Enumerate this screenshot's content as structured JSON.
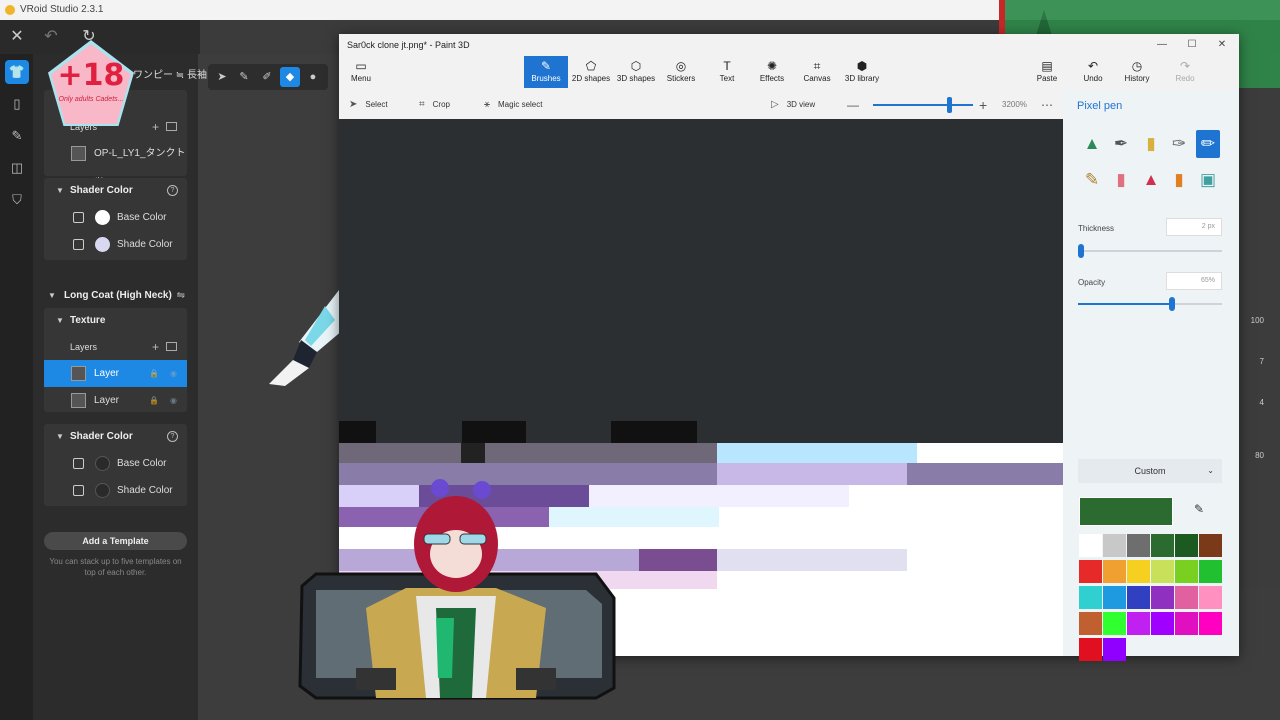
{
  "vroid": {
    "title": "VRoid Studio 2.3.1",
    "tab_label": "ワンピー ≒ 長袖",
    "badge": {
      "number": "+18",
      "caption": "Only adults Cadets..."
    },
    "panel": {
      "layers_label": "Layers",
      "layer_top_name": "OP-L_LY1_タンクトッ",
      "shader_color_1": "Shader Color",
      "base_color": "Base Color",
      "shade_color": "Shade Color",
      "long_coat": "Long Coat (High Neck)",
      "texture": "Texture",
      "layer_1": "Layer",
      "layer_2": "Layer",
      "shader_color_2": "Shader Color",
      "add_template": "Add a Template",
      "template_hint": "You can stack up to five templates on top of each other."
    },
    "right_strip": [
      "100",
      "7",
      "4",
      "80"
    ]
  },
  "paint3d": {
    "title": "Sar0ck clone jt.png* - Paint 3D",
    "ribbon": [
      {
        "icon": "folder-icon",
        "label": "Menu"
      },
      {
        "icon": "brush-icon",
        "label": "Brushes"
      },
      {
        "icon": "shapes-2d-icon",
        "label": "2D shapes"
      },
      {
        "icon": "shapes-3d-icon",
        "label": "3D shapes"
      },
      {
        "icon": "stickers-icon",
        "label": "Stickers"
      },
      {
        "icon": "text-icon",
        "label": "Text"
      },
      {
        "icon": "effects-icon",
        "label": "Effects"
      },
      {
        "icon": "canvas-icon",
        "label": "Canvas"
      },
      {
        "icon": "library-icon",
        "label": "3D library"
      }
    ],
    "ribbon_right": [
      {
        "icon": "paste-icon",
        "label": "Paste"
      },
      {
        "icon": "undo-icon",
        "label": "Undo"
      },
      {
        "icon": "history-icon",
        "label": "History"
      },
      {
        "icon": "redo-icon",
        "label": "Redo"
      }
    ],
    "subbar": {
      "select": "Select",
      "crop": "Crop",
      "magic_select": "Magic select",
      "view_3d": "3D view",
      "zoom": "3200%"
    },
    "panel": {
      "title": "Pixel pen",
      "thickness_label": "Thickness",
      "thickness_value": "2 px",
      "thickness_level": 0.02,
      "opacity_label": "Opacity",
      "opacity_value": "65%",
      "opacity_level": 0.65,
      "custom": "Custom",
      "current_color": "#2b6b2f"
    },
    "palette": [
      "#ffffff",
      "#c8c8c8",
      "#6e6e6e",
      "#2b6b2f",
      "#1c5a22",
      "#7a3a1a",
      "#e62a2a",
      "#f0a030",
      "#f5d020",
      "#c8e05a",
      "#7ad020",
      "#20c030",
      "#30d0d0",
      "#1e9ae0",
      "#3040c0",
      "#9030c0",
      "#e060a0",
      "#ff90c0",
      "#c06030",
      "#30ff30",
      "#c020f0",
      "#a000ff",
      "#e010c0",
      "#ff00c0",
      "#e01020",
      "#9000ff"
    ]
  }
}
